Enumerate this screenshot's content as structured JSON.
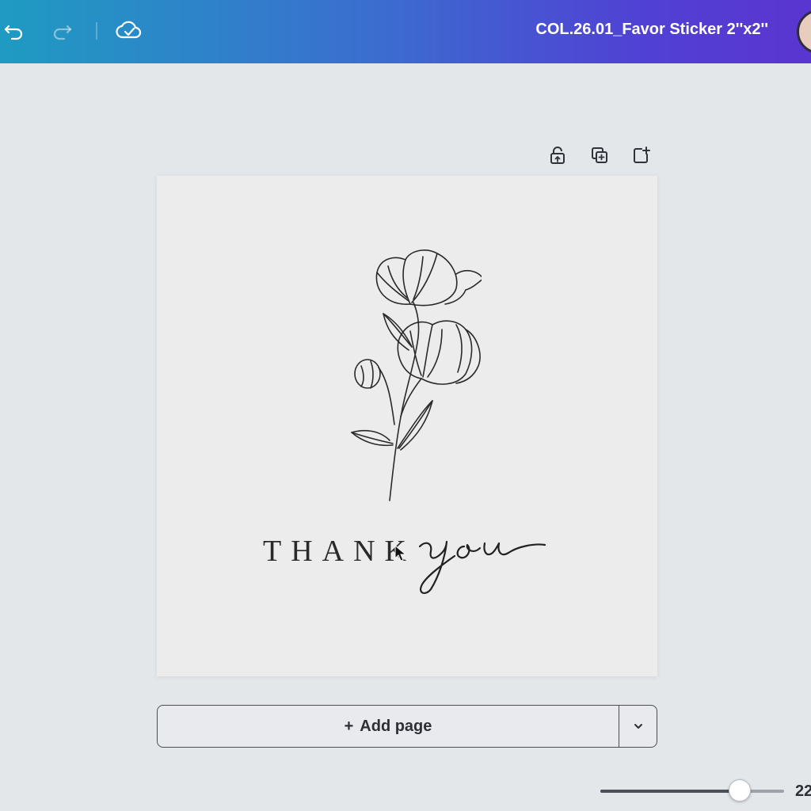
{
  "header": {
    "title": "COL.26.01_Favor Sticker 2''x2''",
    "icons": [
      "undo-icon",
      "redo-icon",
      "cloud-saved-icon"
    ]
  },
  "page_actions": {
    "icons": [
      "lock-icon",
      "duplicate-page-icon",
      "add-page-icon"
    ]
  },
  "design": {
    "text_main": "THANK",
    "text_script": "you"
  },
  "footer": {
    "add_page_label": "Add page",
    "add_page_plus": "+",
    "zoom_value": "22",
    "zoom_fraction": 0.76
  },
  "colors": {
    "header_gradient_start": "#1f9bc2",
    "header_gradient_end": "#5a35d0",
    "canvas_bg": "#e4e7ea",
    "page_bg": "#ececec"
  }
}
